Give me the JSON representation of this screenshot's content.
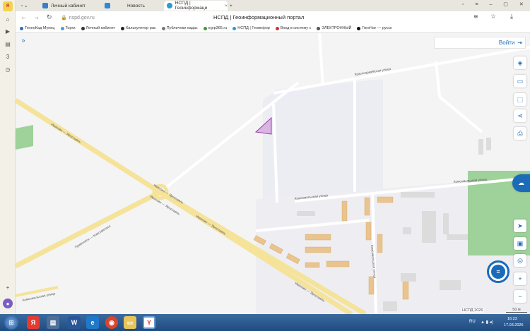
{
  "browser": {
    "tabs": [
      {
        "label": "Личный кабинет",
        "active": false
      },
      {
        "label": "Новость",
        "active": false
      },
      {
        "label": "НСПД | Геоинформаци",
        "active": true
      }
    ],
    "url": "nspd.gov.ru",
    "page_title": "НСПД | Геоинформационный портал",
    "bookmarks": [
      "ТехноКад Муниц",
      "Торги",
      "Личный кабинет",
      "Калькулятор рас",
      "Публичная кадас",
      "egrp365.ru",
      "НСПД | Геоинфор",
      "Вход в систему с",
      "ЭЛЕКТРОННЫЙ",
      "ГигаЧат — русск"
    ]
  },
  "map": {
    "login_label": "Войти",
    "streets": {
      "krasnoarmeyskaya": "Красноармейская улица",
      "komsomolskaya_1": "Комсомольская улица",
      "komsomolskaya_2": "Комсомольская улица",
      "komsomolskaya_3": "Комсомольская улица",
      "komsomolskaya_4": "Комсомольская улица",
      "ivanovo_yaroslavl_1": "Иваново — Ярославль",
      "ivanovo_yaroslavl_2": "Иваново — Ярославль",
      "ivanovo_yaroslavl_3": "Иваново — Ярославль",
      "ivanovo_yaroslavl_4": "Иваново — Ярославль",
      "ivanovo_yaroslavl_5": "Иваново — Ярославль",
      "privolzhsk_komsomolsk": "Приволжск — Комсомольск"
    },
    "attribution": "НСПД 2026",
    "scale": "50 м"
  },
  "taskbar": {
    "lang": "RU",
    "time": "16:23",
    "date": "17.03.2026"
  },
  "colors": {
    "accent": "#1b6bb8",
    "parcel": "#d9b5e3",
    "road": "#f7e79c",
    "building": "#e9c48e"
  }
}
